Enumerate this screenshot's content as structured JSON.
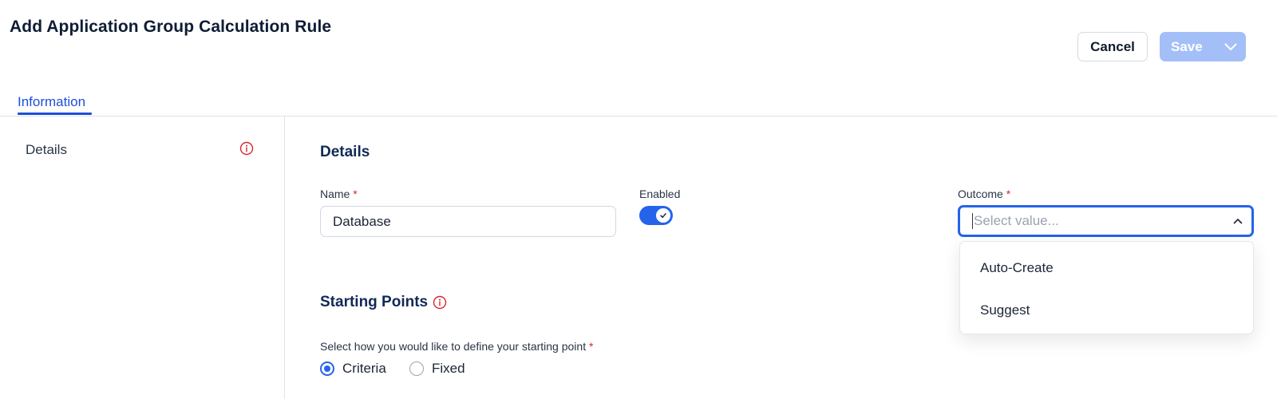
{
  "header": {
    "title": "Add Application Group Calculation Rule",
    "cancel_label": "Cancel",
    "save_label": "Save"
  },
  "tabs": [
    {
      "label": "Information",
      "active": true
    }
  ],
  "sidebar": {
    "items": [
      {
        "label": "Details",
        "icon": "info-circle-icon",
        "status": "error"
      }
    ]
  },
  "details": {
    "section_title": "Details",
    "name": {
      "label": "Name",
      "required_mark": "*",
      "value": "Database"
    },
    "enabled": {
      "label": "Enabled",
      "value": true
    },
    "outcome": {
      "label": "Outcome",
      "required_mark": "*",
      "placeholder": "Select value...",
      "expanded": true,
      "options": [
        "Auto-Create",
        "Suggest"
      ]
    }
  },
  "starting_points": {
    "section_title": "Starting Points",
    "prompt": "Select how you would like to define your starting point",
    "required_mark": "*",
    "options": [
      {
        "label": "Criteria",
        "selected": true
      },
      {
        "label": "Fixed",
        "selected": false
      }
    ]
  },
  "colors": {
    "accent": "#2563eb",
    "tab_active": "#1d4fd8",
    "save_disabled": "#a4bff7",
    "error": "#d9262c",
    "heading": "#102a56"
  }
}
